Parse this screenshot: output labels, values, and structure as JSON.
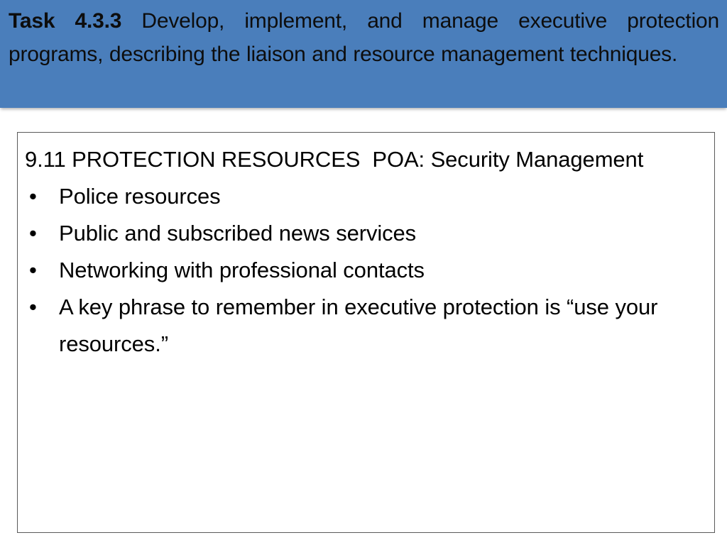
{
  "colors": {
    "banner_background": "#4a7ebb",
    "banner_text": "#0d0d0d",
    "box_border": "#5a5a5a",
    "box_background": "#ffffff",
    "body_text": "#000000"
  },
  "header": {
    "task_label": "Task 4.3.3",
    "task_description": " Develop, implement, and manage executive protection programs, describing the liaison and resource management techniques."
  },
  "content": {
    "heading": "9.11 PROTECTION RESOURCES  POA: Security Management",
    "bullet_marker": "•",
    "bullets": [
      {
        "text": "Police resources"
      },
      {
        "text": "Public and subscribed news services"
      },
      {
        "text": "Networking with professional contacts"
      },
      {
        "text": "A key phrase to remember in executive protection is “use your resources.”"
      }
    ]
  }
}
